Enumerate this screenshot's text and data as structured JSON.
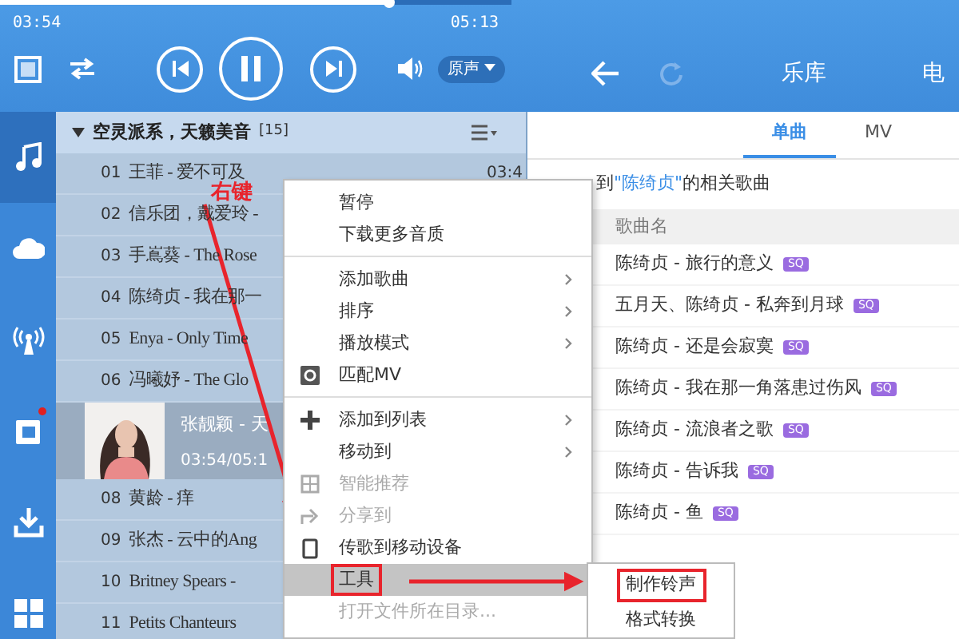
{
  "player": {
    "elapsed": "03:54",
    "duration": "05:13",
    "progress": {
      "level": 0.76
    },
    "sound_mode": "原声"
  },
  "nav": [
    {
      "label": "乐库",
      "selected": false
    },
    {
      "label": "电",
      "selected": false
    }
  ],
  "sidebar": [
    {
      "selected": true,
      "badge": false
    },
    {
      "selected": false,
      "badge": false
    },
    {
      "selected": false,
      "badge": false
    },
    {
      "selected": false,
      "badge": true
    },
    {
      "selected": false,
      "badge": false
    },
    {
      "selected": false,
      "badge": false
    }
  ],
  "playlist": {
    "title": "空灵派系，天籁美音",
    "count": "[15]",
    "expanded": true,
    "rows": [
      {
        "kind": "track",
        "number": "01",
        "title": "王菲 - 爱不可及",
        "duration": "03:4"
      },
      {
        "kind": "track",
        "number": "02",
        "title": "信乐团，戴爱玲 -"
      },
      {
        "kind": "track",
        "number": "03",
        "title": "手嶌葵 - The Rose"
      },
      {
        "kind": "track",
        "number": "04",
        "title": "陈绮贞 - 我在那一"
      },
      {
        "kind": "track",
        "number": "05",
        "title": "Enya - Only Time"
      },
      {
        "kind": "track",
        "number": "06",
        "title": "冯曦妤 - The Glo"
      },
      {
        "kind": "playing",
        "title": "张靓颖 - 天",
        "time": "03:54/05:1"
      },
      {
        "kind": "track",
        "number": "08",
        "title": "黄龄 - 痒"
      },
      {
        "kind": "track",
        "number": "09",
        "title": "张杰 - 云中的Ang"
      },
      {
        "kind": "track",
        "number": "10",
        "title": "Britney Spears -"
      },
      {
        "kind": "track",
        "number": "11",
        "title": "Petits Chanteurs"
      }
    ]
  },
  "annotation": {
    "label": "右键"
  },
  "library": {
    "tabs": [
      {
        "label": "单曲",
        "selected": true
      },
      {
        "label": "MV",
        "selected": false
      }
    ],
    "result_prefix": "到",
    "query": "\"陈绮贞\"",
    "result_suffix": "的相关歌曲",
    "column": "歌曲名",
    "songs": [
      {
        "title": "陈绮贞 - 旅行的意义",
        "badge": "SQ"
      },
      {
        "title": "五月天、陈绮贞 - 私奔到月球",
        "badge": "SQ"
      },
      {
        "title": "陈绮贞 - 还是会寂寞",
        "badge": "SQ"
      },
      {
        "title": "陈绮贞 - 我在那一角落患过伤风",
        "badge": "SQ"
      },
      {
        "title": "陈绮贞 - 流浪者之歌",
        "badge": "SQ"
      },
      {
        "title": "陈绮贞 - 告诉我",
        "badge": "SQ"
      },
      {
        "title": "陈绮贞 - 鱼",
        "badge": "SQ"
      }
    ]
  },
  "context_menu": [
    {
      "kind": "item",
      "label": "暂停",
      "submenu": false,
      "disabled": false,
      "highlighted": false,
      "boxed": false
    },
    {
      "kind": "item",
      "label": "下载更多音质",
      "submenu": false,
      "disabled": false,
      "highlighted": false,
      "boxed": false
    },
    {
      "kind": "separator"
    },
    {
      "kind": "item",
      "label": "添加歌曲",
      "submenu": true,
      "disabled": false,
      "highlighted": false,
      "boxed": false
    },
    {
      "kind": "item",
      "label": "排序",
      "submenu": true,
      "disabled": false,
      "highlighted": false,
      "boxed": false
    },
    {
      "kind": "item",
      "label": "播放模式",
      "submenu": true,
      "disabled": false,
      "highlighted": false,
      "boxed": false
    },
    {
      "kind": "item",
      "label": "匹配MV",
      "submenu": false,
      "disabled": false,
      "highlighted": false,
      "boxed": false
    },
    {
      "kind": "separator"
    },
    {
      "kind": "item",
      "label": "添加到列表",
      "submenu": true,
      "disabled": false,
      "highlighted": false,
      "boxed": false
    },
    {
      "kind": "item",
      "label": "移动到",
      "submenu": true,
      "disabled": false,
      "highlighted": false,
      "boxed": false
    },
    {
      "kind": "item",
      "label": "智能推荐",
      "submenu": false,
      "disabled": true,
      "highlighted": false,
      "boxed": false
    },
    {
      "kind": "item",
      "label": "分享到",
      "submenu": false,
      "disabled": true,
      "highlighted": false,
      "boxed": false
    },
    {
      "kind": "item",
      "label": "传歌到移动设备",
      "submenu": false,
      "disabled": false,
      "highlighted": false,
      "boxed": false
    },
    {
      "kind": "item",
      "label": "工具",
      "submenu": false,
      "disabled": false,
      "highlighted": true,
      "boxed": true
    },
    {
      "kind": "item",
      "label": "打开文件所在目录...",
      "submenu": false,
      "disabled": true,
      "highlighted": false,
      "boxed": false
    }
  ],
  "submenu": [
    {
      "label": "制作铃声",
      "boxed": true
    },
    {
      "label": "格式转换",
      "boxed": false
    }
  ]
}
